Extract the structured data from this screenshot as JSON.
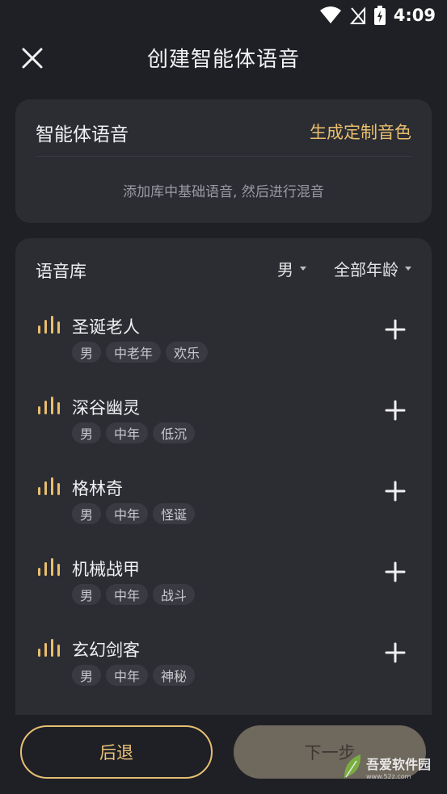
{
  "status": {
    "time": "4:09"
  },
  "header": {
    "title": "创建智能体语音"
  },
  "voice_card": {
    "title": "智能体语音",
    "generate_label": "生成定制音色",
    "hint": "添加库中基础语音, 然后进行混音"
  },
  "library": {
    "title": "语音库",
    "gender_filter": "男",
    "age_filter": "全部年龄",
    "items": [
      {
        "name": "圣诞老人",
        "tags": [
          "男",
          "中老年",
          "欢乐"
        ]
      },
      {
        "name": "深谷幽灵",
        "tags": [
          "男",
          "中年",
          "低沉"
        ]
      },
      {
        "name": "格林奇",
        "tags": [
          "男",
          "中年",
          "怪诞"
        ]
      },
      {
        "name": "机械战甲",
        "tags": [
          "男",
          "中年",
          "战斗"
        ]
      },
      {
        "name": "玄幻剑客",
        "tags": [
          "男",
          "中年",
          "神秘"
        ]
      }
    ]
  },
  "footer": {
    "back_label": "后退",
    "next_label": "下一步"
  },
  "watermark": {
    "text": "吾爱软件园",
    "url": "www.52z.com"
  },
  "colors": {
    "accent": "#e9be6d",
    "background": "#1f2025",
    "card": "#2c2d33"
  }
}
